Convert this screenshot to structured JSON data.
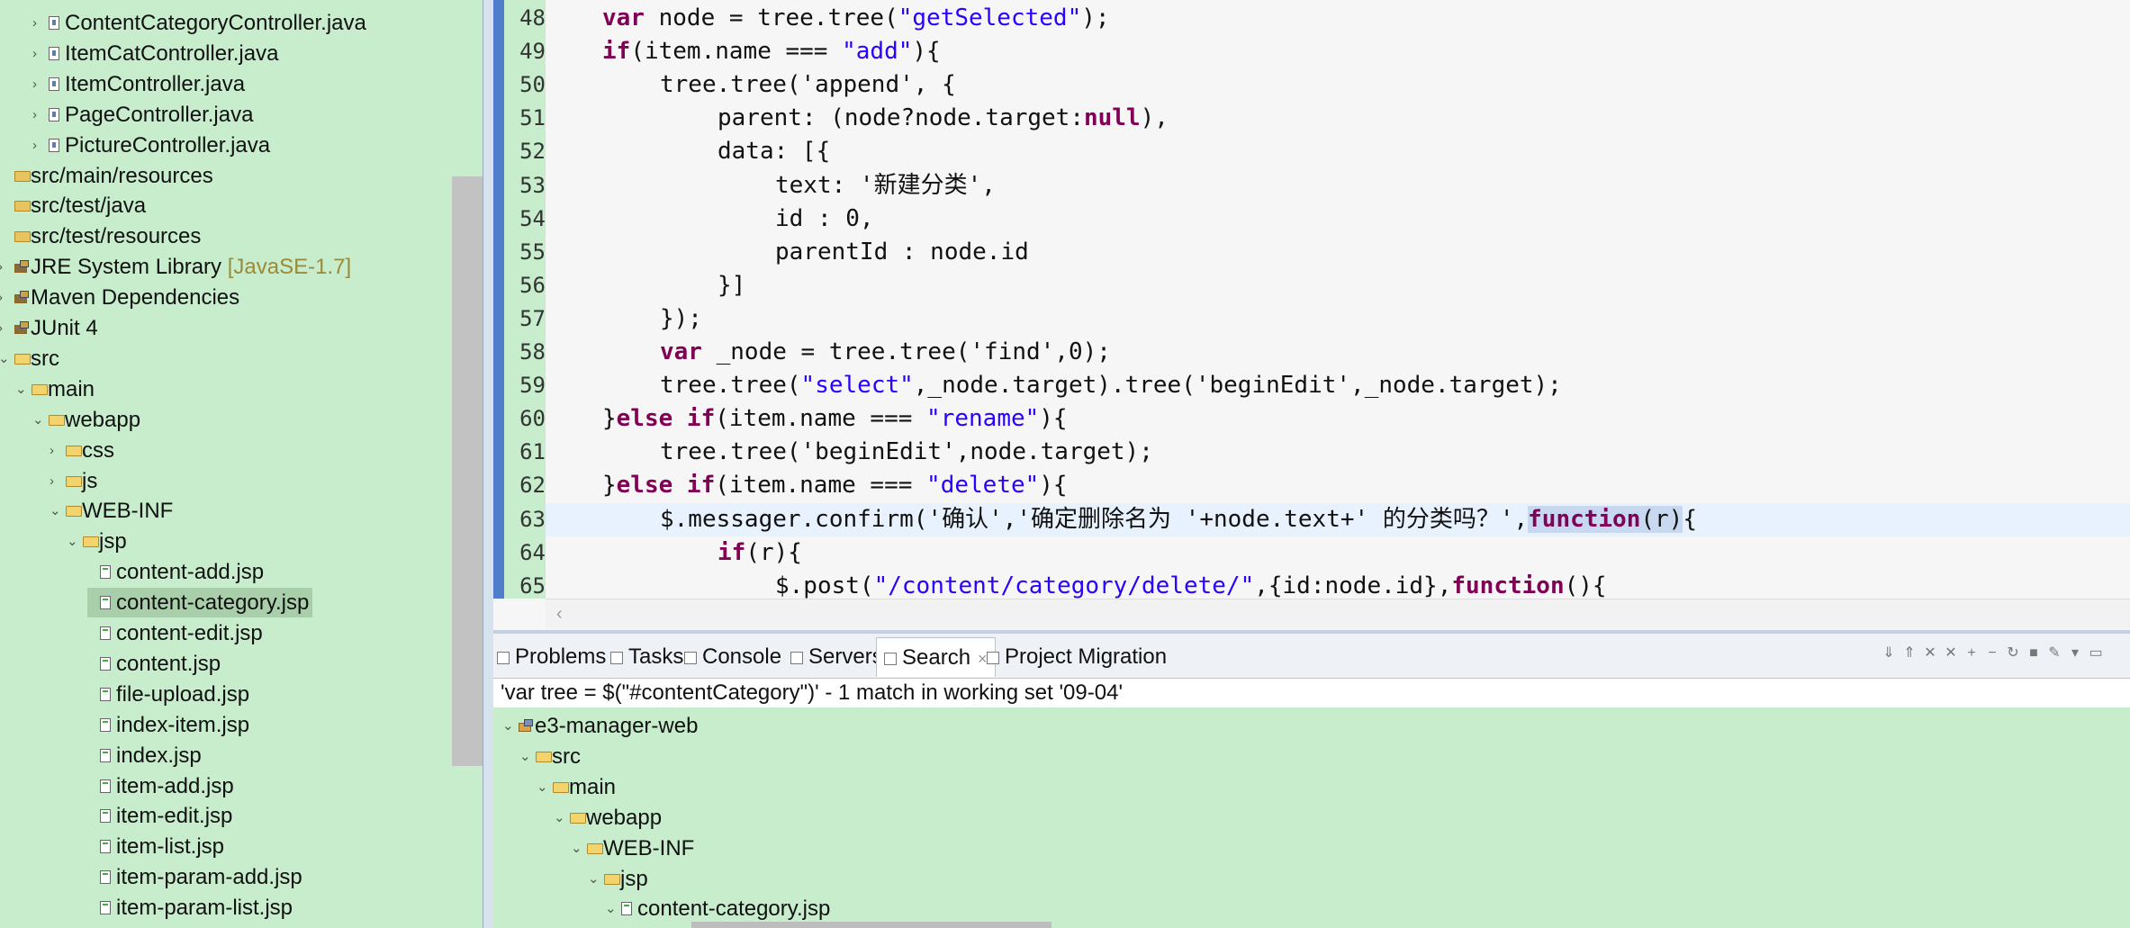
{
  "explorer": {
    "items": [
      {
        "label": "ContentCategoryController.java",
        "kind": "java",
        "depth": 2
      },
      {
        "label": "ItemCatController.java",
        "kind": "java",
        "depth": 2
      },
      {
        "label": "ItemController.java",
        "kind": "java",
        "depth": 2
      },
      {
        "label": "PageController.java",
        "kind": "java",
        "depth": 2
      },
      {
        "label": "PictureController.java",
        "kind": "java",
        "depth": 2
      },
      {
        "label": "src/main/resources",
        "kind": "srcfolder",
        "depth": 0
      },
      {
        "label": "src/test/java",
        "kind": "srcfolder",
        "depth": 0
      },
      {
        "label": "src/test/resources",
        "kind": "srcfolder",
        "depth": 0
      },
      {
        "label": "JRE System Library",
        "decoration": "[JavaSE-1.7]",
        "kind": "library",
        "depth": 0
      },
      {
        "label": "Maven Dependencies",
        "kind": "library",
        "depth": 0
      },
      {
        "label": "JUnit 4",
        "kind": "library",
        "depth": 0
      },
      {
        "label": "src",
        "kind": "folder",
        "depth": 0
      },
      {
        "label": "main",
        "kind": "folder",
        "depth": 1
      },
      {
        "label": "webapp",
        "kind": "folder",
        "depth": 2
      },
      {
        "label": "css",
        "kind": "folder",
        "depth": 3
      },
      {
        "label": "js",
        "kind": "folder",
        "depth": 3
      },
      {
        "label": "WEB-INF",
        "kind": "folder",
        "depth": 3
      },
      {
        "label": "jsp",
        "kind": "folder",
        "depth": 4
      },
      {
        "label": "content-add.jsp",
        "kind": "jsp",
        "depth": 5
      },
      {
        "label": "content-category.jsp",
        "kind": "jsp",
        "depth": 5,
        "selected": true
      },
      {
        "label": "content-edit.jsp",
        "kind": "jsp",
        "depth": 5
      },
      {
        "label": "content.jsp",
        "kind": "jsp",
        "depth": 5
      },
      {
        "label": "file-upload.jsp",
        "kind": "jsp",
        "depth": 5
      },
      {
        "label": "index-item.jsp",
        "kind": "jsp",
        "depth": 5
      },
      {
        "label": "index.jsp",
        "kind": "jsp",
        "depth": 5
      },
      {
        "label": "item-add.jsp",
        "kind": "jsp",
        "depth": 5
      },
      {
        "label": "item-edit.jsp",
        "kind": "jsp",
        "depth": 5
      },
      {
        "label": "item-list.jsp",
        "kind": "jsp",
        "depth": 5
      },
      {
        "label": "item-param-add.jsp",
        "kind": "jsp",
        "depth": 5
      },
      {
        "label": "item-param-list.jsp",
        "kind": "jsp",
        "depth": 5
      }
    ]
  },
  "editor": {
    "lines": [
      {
        "n": "48",
        "indent": 1,
        "tokens": [
          [
            "kw",
            "var"
          ],
          [
            "t",
            " node = tree.tree("
          ],
          [
            "str",
            "\"getSelected\""
          ],
          [
            "t",
            ");"
          ]
        ]
      },
      {
        "n": "49",
        "indent": 1,
        "tokens": [
          [
            "kw",
            "if"
          ],
          [
            "t",
            "(item.name === "
          ],
          [
            "str",
            "\"add\""
          ],
          [
            "t",
            "){"
          ]
        ]
      },
      {
        "n": "50",
        "indent": 2,
        "tokens": [
          [
            "t",
            "tree.tree('append', {"
          ]
        ]
      },
      {
        "n": "51",
        "indent": 3,
        "tokens": [
          [
            "t",
            "parent: (node?node.target:"
          ],
          [
            "kw",
            "null"
          ],
          [
            "t",
            "),"
          ]
        ]
      },
      {
        "n": "52",
        "indent": 3,
        "tokens": [
          [
            "t",
            "data: [{"
          ]
        ]
      },
      {
        "n": "53",
        "indent": 4,
        "tokens": [
          [
            "t",
            "text: '新建分类',"
          ]
        ]
      },
      {
        "n": "54",
        "indent": 4,
        "tokens": [
          [
            "t",
            "id : 0,"
          ]
        ]
      },
      {
        "n": "55",
        "indent": 4,
        "tokens": [
          [
            "t",
            "parentId : node.id"
          ]
        ]
      },
      {
        "n": "56",
        "indent": 3,
        "tokens": [
          [
            "t",
            "}]"
          ]
        ]
      },
      {
        "n": "57",
        "indent": 2,
        "tokens": [
          [
            "t",
            "});"
          ]
        ]
      },
      {
        "n": "58",
        "indent": 2,
        "tokens": [
          [
            "kw",
            "var"
          ],
          [
            "t",
            " _node = tree.tree('find',0);"
          ]
        ]
      },
      {
        "n": "59",
        "indent": 2,
        "tokens": [
          [
            "t",
            "tree.tree("
          ],
          [
            "str",
            "\"select\""
          ],
          [
            "t",
            ",_node.target).tree('beginEdit',_node.target);"
          ]
        ]
      },
      {
        "n": "60",
        "indent": 1,
        "tokens": [
          [
            "t",
            "}"
          ],
          [
            "kw",
            "else if"
          ],
          [
            "t",
            "(item.name === "
          ],
          [
            "str",
            "\"rename\""
          ],
          [
            "t",
            "){"
          ]
        ]
      },
      {
        "n": "61",
        "indent": 2,
        "tokens": [
          [
            "t",
            "tree.tree('beginEdit',node.target);"
          ]
        ]
      },
      {
        "n": "62",
        "indent": 1,
        "tokens": [
          [
            "t",
            "}"
          ],
          [
            "kw",
            "else if"
          ],
          [
            "t",
            "(item.name === "
          ],
          [
            "str",
            "\"delete\""
          ],
          [
            "t",
            "){"
          ]
        ]
      },
      {
        "n": "63",
        "indent": 2,
        "current": true,
        "tokens": [
          [
            "t",
            "$.messager.confirm('确认','确定删除名为 '+node.text+' 的分类吗？',"
          ],
          [
            "kwh",
            "function"
          ],
          [
            "th",
            "(r)"
          ],
          [
            "t",
            "{"
          ]
        ]
      },
      {
        "n": "64",
        "indent": 3,
        "tokens": [
          [
            "kw",
            "if"
          ],
          [
            "t",
            "(r){"
          ]
        ]
      },
      {
        "n": "65",
        "indent": 4,
        "tokens": [
          [
            "t",
            "$.post("
          ],
          [
            "str",
            "\"/content/category/delete/\""
          ],
          [
            "t",
            ",{id:node.id},"
          ],
          [
            "kw",
            "function"
          ],
          [
            "t",
            "(){"
          ]
        ]
      }
    ]
  },
  "panel": {
    "tabs": [
      {
        "label": "Problems",
        "icon": "problems-icon"
      },
      {
        "label": "Tasks",
        "icon": "tasks-icon"
      },
      {
        "label": "Console",
        "icon": "console-icon"
      },
      {
        "label": "Servers",
        "icon": "servers-icon"
      },
      {
        "label": "Search",
        "icon": "search-icon",
        "active": true
      },
      {
        "label": "Project Migration",
        "icon": "migration-icon"
      }
    ],
    "close_glyph": "×",
    "summary": "'var tree = $(\"#contentCategory\")' - 1 match in working set '09-04'",
    "results": [
      {
        "label": "e3-manager-web",
        "kind": "project",
        "depth": 0
      },
      {
        "label": "src",
        "kind": "folder",
        "depth": 1
      },
      {
        "label": "main",
        "kind": "folder",
        "depth": 2
      },
      {
        "label": "webapp",
        "kind": "folder",
        "depth": 3
      },
      {
        "label": "WEB-INF",
        "kind": "folder",
        "depth": 4
      },
      {
        "label": "jsp",
        "kind": "folder",
        "depth": 5
      },
      {
        "label": "content-category.jsp",
        "kind": "jsp",
        "depth": 6
      }
    ]
  },
  "glyphs": {
    "expanded": "⌄",
    "collapsed": "›",
    "scroll_left": "‹"
  },
  "colors": {
    "background": "#c7edcc",
    "keyword": "#7f0055",
    "string": "#2a00ff",
    "ruler": "#4f7ccc"
  }
}
